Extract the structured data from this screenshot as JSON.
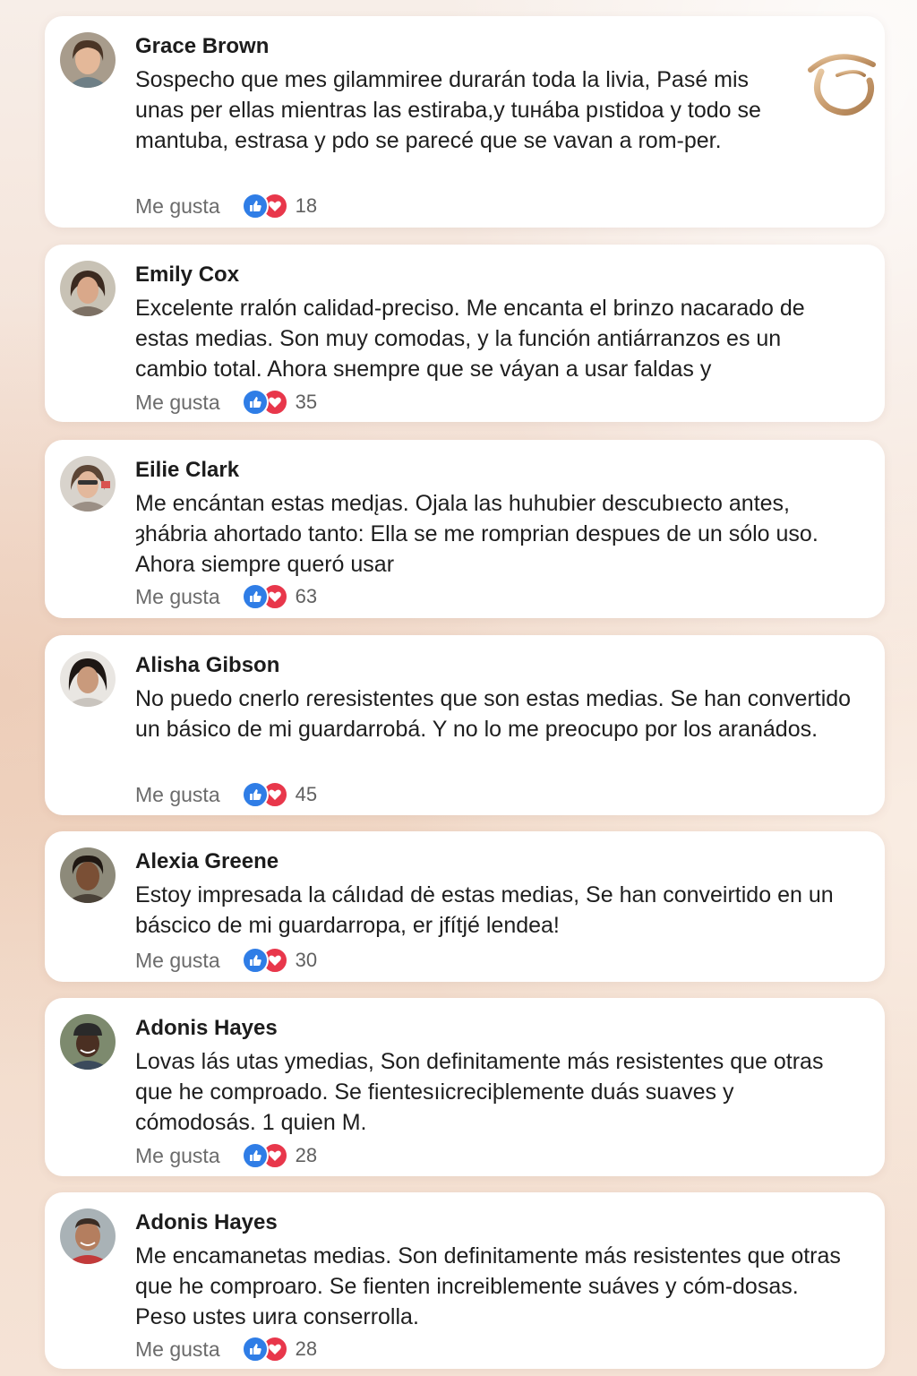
{
  "like_label": "Me gusta",
  "colors": {
    "like_blue": "#2f7de6",
    "love_red": "#e8374b",
    "logo_gold": "#c79a6c"
  },
  "brand": {
    "icon": "gold-swirl-logo-icon"
  },
  "comments": [
    {
      "name": "Grace Brown",
      "text": "Sospecho que mes gilammiree durarán toda la livia, Pasé mis unas per ellas mientras las estiraba,y tuнába pıstidoa y todo se mantuba, estrasa y pdo se parecé que se vavan a rom-per.",
      "count": "18"
    },
    {
      "name": "Emily Cox",
      "text": "Excelente rralón calidad-preciso. Me encanta el brinzo nacarado de estas medias. Son muy comodas, y la función antiárranzos es un cambio total. Ahora sнempre que se váyan a usar faldas y",
      "count": "35"
    },
    {
      "name": "Eilie Clark",
      "text": "Me encántan estas medįas. Ojala las huhubier descubıecto antes, ȝhábria ahortado tanto: Ella se me romprian despues de un sólo uso. Ahora siempre queró usar",
      "count": "63"
    },
    {
      "name": "Alisha Gibson",
      "text": "No puedo cnerlo ɾeresistentes que son estas medias. Se han convertido un básico de mi guardarrobá. Y no lo me preocupo por los aranádos.",
      "count": "45"
    },
    {
      "name": "Alexia Greene",
      "text": "Estoy impresada la cálıdad dė estas medias, Se han conveirtido en un báscico de mi guardarropa, er jfítjé lendea!",
      "count": "30"
    },
    {
      "name": "Adonis Hayes",
      "text": "Lovas lás utas ymedias, Son definitamente más resistentes que otras que he comproado.  Se fientesıicreciþlemente duás suaves y cómodosás. 1 quien M.",
      "count": "28"
    },
    {
      "name": "Adonis Hayes",
      "text": "Me encamanetas medias. Son definitamente más resistentes  que otras que he comproaro. Se fienten increiblemente suáves y cóm-dosas. Peso ustes uиra conserrolla.",
      "count": "28"
    }
  ]
}
